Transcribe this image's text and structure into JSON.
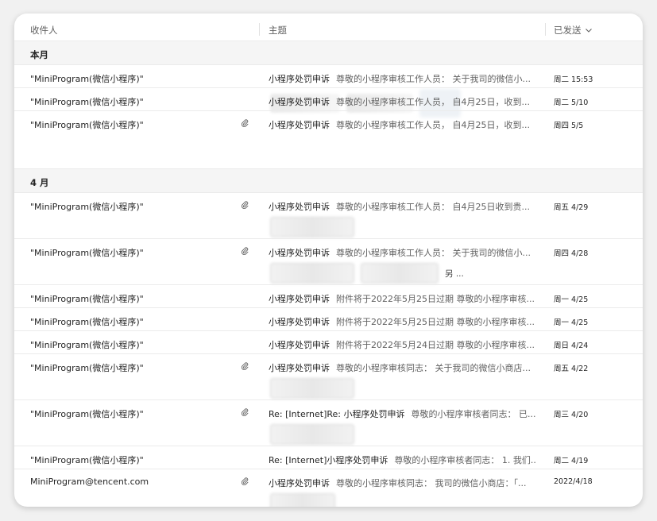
{
  "columns": {
    "to": "收件人",
    "subject": "主题",
    "sent": "已发送"
  },
  "groups": [
    {
      "label": "本月",
      "rows": [
        {
          "sender": "\"MiniProgram(微信小程序)\"",
          "subject": "小程序处罚申诉",
          "preview": "尊敬的小程序审核工作人员：  关于我司的微信小...",
          "date": "周二 15:53",
          "attachment": false
        },
        {
          "sender": "\"MiniProgram(微信小程序)\"",
          "subject": "小程序处罚申诉",
          "preview": "尊敬的小程序审核工作人员，  自4月25日，收到...",
          "date": "周二 5/10",
          "attachment": false
        },
        {
          "sender": "\"MiniProgram(微信小程序)\"",
          "subject": "小程序处罚申诉",
          "preview": "尊敬的小程序审核工作人员，  自4月25日，收到...",
          "date": "周四 5/5",
          "attachment": true
        }
      ]
    },
    {
      "label": "4 月",
      "rows": [
        {
          "sender": "\"MiniProgram(微信小程序)\"",
          "subject": "小程序处罚申诉",
          "preview": "尊敬的小程序审核工作人员：  自4月25日收到贵...",
          "date": "周五 4/29",
          "attachment": true
        },
        {
          "sender": "\"MiniProgram(微信小程序)\"",
          "subject": "小程序处罚申诉",
          "preview": "尊敬的小程序审核工作人员：  关于我司的微信小...",
          "date": "周四 4/28",
          "attachment": true,
          "more_label": "另 ..."
        },
        {
          "sender": "\"MiniProgram(微信小程序)\"",
          "subject": "小程序处罚申诉",
          "preview": "附件将于2022年5月25日过期  尊敬的小程序审核...",
          "date": "周一 4/25",
          "attachment": false
        },
        {
          "sender": "\"MiniProgram(微信小程序)\"",
          "subject": "小程序处罚申诉",
          "preview": "附件将于2022年5月25日过期  尊敬的小程序审核...",
          "date": "周一 4/25",
          "attachment": false
        },
        {
          "sender": "\"MiniProgram(微信小程序)\"",
          "subject": "小程序处罚申诉",
          "preview": "附件将于2022年5月24日过期  尊敬的小程序审核...",
          "date": "周日 4/24",
          "attachment": false
        },
        {
          "sender": "\"MiniProgram(微信小程序)\"",
          "subject": "小程序处罚申诉",
          "preview": "尊敬的小程序审核同志：  关于我司的微信小商店...",
          "date": "周五 4/22",
          "attachment": true
        },
        {
          "sender": "\"MiniProgram(微信小程序)\"",
          "subject": "Re: [Internet]Re: 小程序处罚申诉",
          "preview": "尊敬的小程序审核者同志：  已...",
          "date": "周三 4/20",
          "attachment": true
        },
        {
          "sender": "\"MiniProgram(微信小程序)\"",
          "subject": "Re: [Internet]小程序处罚申诉",
          "preview": "尊敬的小程序审核者同志：  1. 我们...",
          "date": "周二 4/19",
          "attachment": false
        },
        {
          "sender": "MiniProgram@tencent.com",
          "subject": "小程序处罚申诉",
          "preview": "尊敬的小程序审核同志：  我司的微信小商店：「...",
          "date": "2022/4/18",
          "attachment": true
        }
      ]
    }
  ],
  "icons": {
    "attachment": "paperclip-icon",
    "sort": "chevron-down-icon"
  },
  "colors": {
    "text": "#242424",
    "muted": "#616161",
    "group_bg": "#f5f5f5",
    "border": "#ebebeb"
  }
}
